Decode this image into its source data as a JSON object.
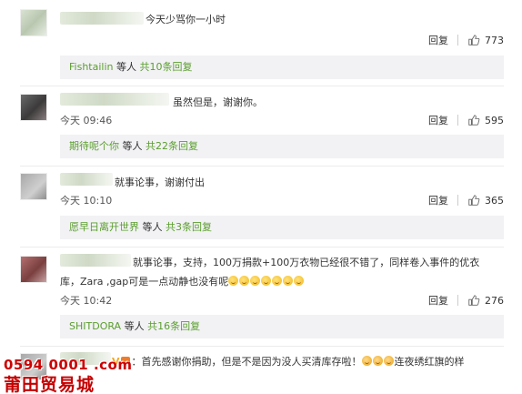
{
  "comments": [
    {
      "text": "今天少骂你一小时",
      "time": "",
      "reply_label": "回复",
      "likes": "773",
      "replies": {
        "who": "Fishtailin",
        "etc": " 等人 ",
        "count": "共10条回复"
      }
    },
    {
      "text": "虽然但是，谢谢你。",
      "time": "今天 09:46",
      "reply_label": "回复",
      "likes": "595",
      "replies": {
        "who": "期待呢个你",
        "etc": " 等人 ",
        "count": "共22条回复"
      }
    },
    {
      "text": "就事论事，谢谢付出",
      "time": "今天 10:10",
      "reply_label": "回复",
      "likes": "365",
      "replies": {
        "who": "愿早日离开世界",
        "etc": " 等人 ",
        "count": "共3条回复"
      }
    },
    {
      "text": "就事论事，支持，100万捐款+100万衣物已经很不错了，同样卷入事件的优衣",
      "text2": "库，Zara ,gap可是一点动静也没有呢",
      "time": "今天 10:42",
      "reply_label": "回复",
      "likes": "276",
      "replies": {
        "who": "SHITDORA",
        "etc": " 等人 ",
        "count": "共16条回复"
      }
    },
    {
      "text": "：首先感谢你捐助，但是不是因为没人买清库存啦！",
      "text_tail": "连夜绣红旗的样"
    }
  ],
  "watermark": {
    "line1": "0594 0001 .com",
    "line2": "莆田贸易城"
  },
  "icons": {
    "like": "thumbs-up-icon",
    "emoji": "smiley-emoji-icon"
  },
  "colors": {
    "link_green": "#5b9e2d",
    "reply_bg": "#f2f2f5",
    "watermark_red": "#cc0000"
  }
}
